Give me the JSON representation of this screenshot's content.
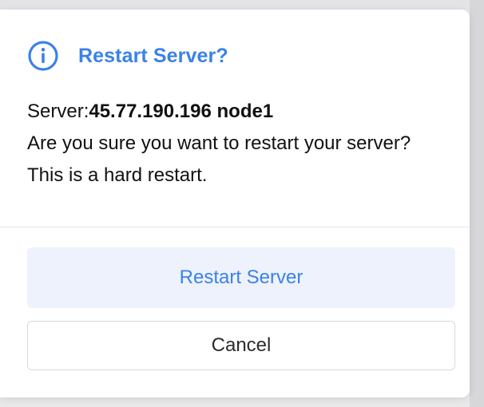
{
  "dialog": {
    "icon": "info-circle-icon",
    "title": "Restart Server?",
    "server_label": "Server:",
    "server_value": "45.77.190.196 node1",
    "message": "Are you sure you want to restart your server? This is a hard restart.",
    "confirm_label": "Restart Server",
    "cancel_label": "Cancel"
  },
  "colors": {
    "accent": "#3b82e6",
    "confirm_bg": "#edf2fd",
    "text": "#111111"
  }
}
